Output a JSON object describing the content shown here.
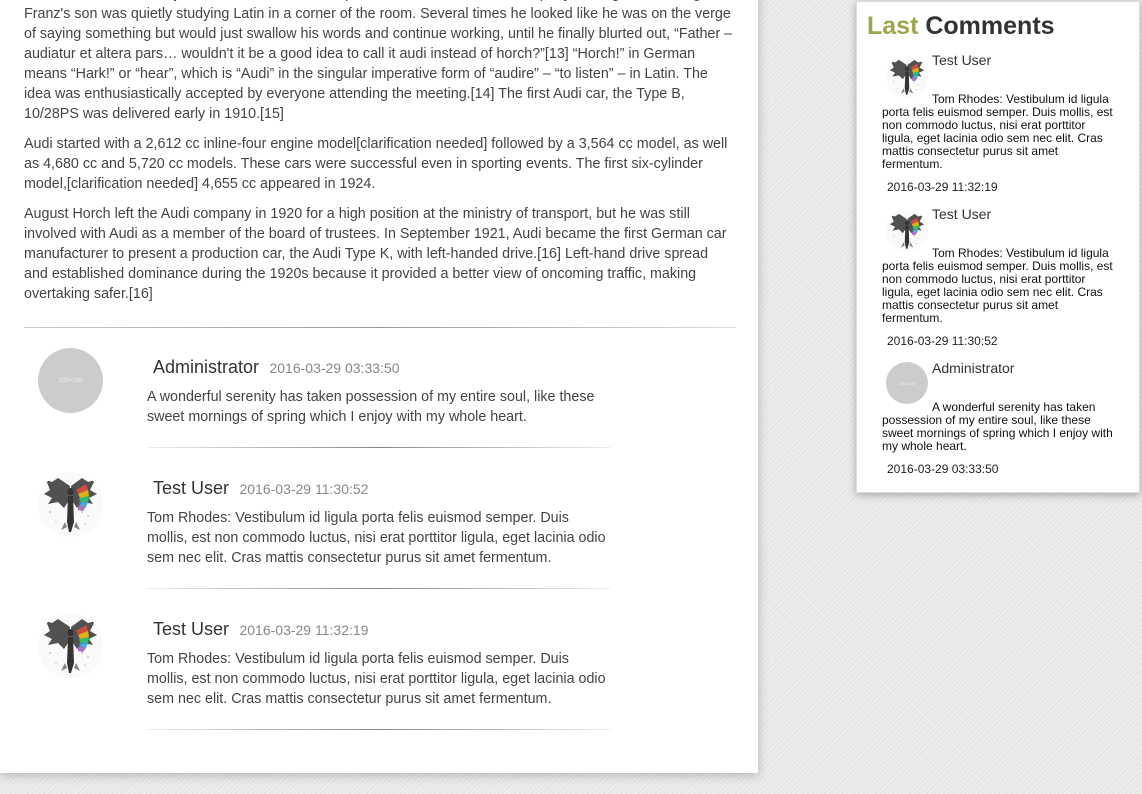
{
  "article": {
    "paragraphs": [
      "Franz Finkentscher, they discussed how to come up with a new name for the company. During this meeting, Franz's son was quietly studying Latin in a corner of the room. Several times he looked like he was on the verge of saying something but would just swallow his words and continue working, until he finally blurted out, “Father – audiatur et altera pars… wouldn't it be a good idea to call it audi instead of horch?”[13] “Horch!” in German means “Hark!” or “hear”, which is “Audi” in the singular imperative form of “audire” – “to listen” – in Latin. The idea was enthusiastically accepted by everyone attending the meeting.[14] The first Audi car, the Type B, 10/28PS was delivered early in 1910.[15]",
      "Audi started with a 2,612 cc inline-four engine model[clarification needed] followed by a 3,564 cc model, as well as 4,680 cc and 5,720 cc models. These cars were successful even in sporting events. The first six-cylinder model,[clarification needed] 4,655 cc appeared in 1924.",
      "August Horch left the Audi company in 1920 for a high position at the ministry of transport, but he was still involved with Audi as a member of the board of trustees. In September 1921, Audi became the first German car manufacturer to present a production car, the Audi Type K, with left-handed drive.[16] Left-hand drive spread and established dominance during the 1920s because it provided a better view of oncoming traffic, making overtaking safer.[16]"
    ]
  },
  "comments": [
    {
      "author": "Administrator",
      "date": "2016-03-29 03:33:50",
      "avatar_label": "100×100",
      "text": "A wonderful serenity has taken possession of my entire soul, like these sweet mornings of spring which I enjoy with my whole heart."
    },
    {
      "author": "Test User",
      "date": "2016-03-29 11:30:52",
      "text": "Tom Rhodes: Vestibulum id ligula porta felis euismod semper. Duis mollis, est non commodo luctus, nisi erat porttitor ligula, eget lacinia odio sem nec elit. Cras mattis consectetur purus sit amet fermentum."
    },
    {
      "author": "Test User",
      "date": "2016-03-29 11:32:19",
      "text": "Tom Rhodes: Vestibulum id ligula porta felis euismod semper. Duis mollis, est non commodo luctus, nisi erat porttitor ligula, eget lacinia odio sem nec elit. Cras mattis consectetur purus sit amet fermentum."
    }
  ],
  "sidebar": {
    "title_part1": "Last",
    "title_part2": "Comments",
    "items": [
      {
        "author": "Test User",
        "text": "Tom Rhodes: Vestibulum id ligula porta felis euismod semper. Duis mollis, est non commodo luctus, nisi erat porttitor ligula, eget lacinia odio sem nec elit. Cras mattis consectetur purus sit amet fermentum.",
        "date": "2016-03-29 11:32:19"
      },
      {
        "author": "Test User",
        "text": "Tom Rhodes: Vestibulum id ligula porta felis euismod semper. Duis mollis, est non commodo luctus, nisi erat porttitor ligula, eget lacinia odio sem nec elit. Cras mattis consectetur purus sit amet fermentum.",
        "date": "2016-03-29 11:30:52"
      },
      {
        "author": "Administrator",
        "avatar_label": "100×100",
        "text": "A wonderful serenity has taken possession of my entire soul, like these sweet mornings of spring which I enjoy with my whole heart.",
        "date": "2016-03-29 03:33:50"
      }
    ]
  },
  "colors": {
    "accent": "#9ea54d",
    "page_bg": "#e9e9e9"
  }
}
